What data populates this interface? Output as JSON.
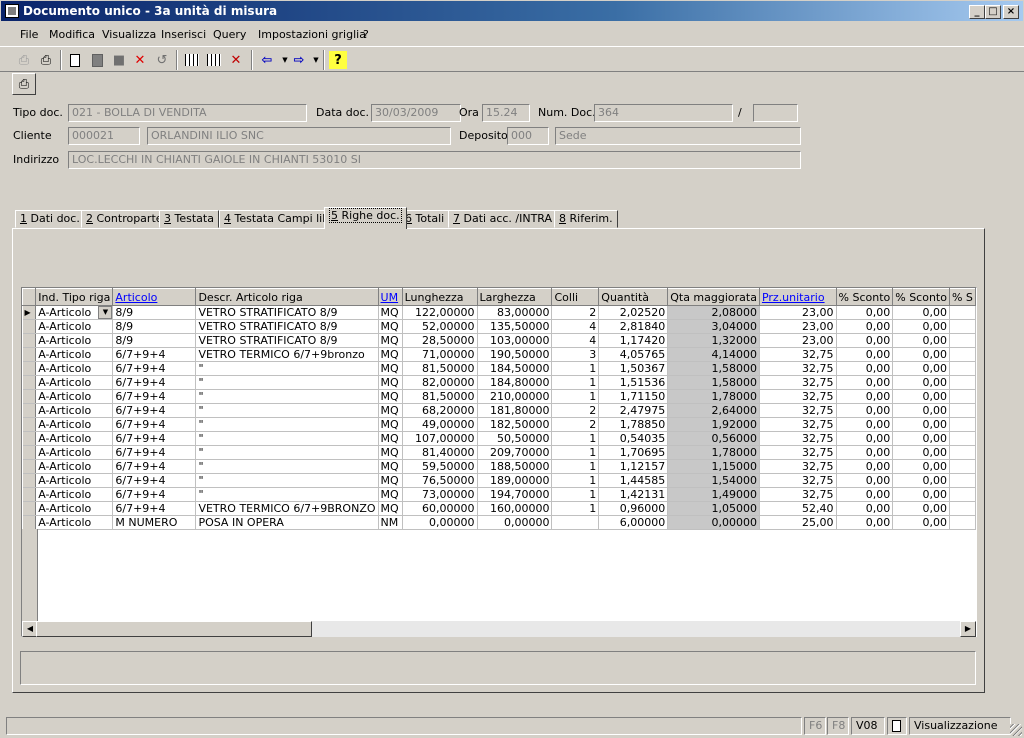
{
  "window": {
    "title": "Documento unico - 3a unità di misura"
  },
  "menu": [
    {
      "label": "File"
    },
    {
      "label": "Modifica"
    },
    {
      "label": "Visualizza"
    },
    {
      "label": "Inserisci"
    },
    {
      "label": "Query"
    },
    {
      "label": "Impostazioni griglia"
    },
    {
      "label": "?"
    }
  ],
  "toolbar_icons": [
    "print-preview-icon",
    "print-icon",
    "new-document-icon",
    "copy-document-icon",
    "save-icon",
    "delete-icon",
    "undo-icon",
    "grid-add-icon",
    "grid-icon",
    "grid-delete-icon",
    "back-arrow-icon",
    "forward-arrow-icon",
    "help-icon",
    "print-icon"
  ],
  "header": {
    "tipo_doc_label": "Tipo doc.",
    "tipo_doc": "021 - BOLLA DI VENDITA",
    "data_doc_label": "Data doc.",
    "data_doc": "30/03/2009",
    "ora_label": "Ora",
    "ora": "15.24",
    "num_doc_label": "Num. Doc.",
    "num_doc": "364",
    "slash": "/",
    "num_doc_suffix": "",
    "cliente_label": "Cliente",
    "cliente_code": "000021",
    "cliente_name": "ORLANDINI ILIO SNC",
    "deposito_label": "Deposito",
    "deposito_code": "000",
    "deposito_name": "Sede",
    "indirizzo_label": "Indirizzo",
    "indirizzo": "LOC.LECCHI IN CHIANTI GAIOLE IN CHIANTI 53010 SI"
  },
  "tabs": [
    {
      "num": "1",
      "label": " Dati doc."
    },
    {
      "num": "2",
      "label": " Controparte"
    },
    {
      "num": "3",
      "label": " Testata"
    },
    {
      "num": "4",
      "label": " Testata Campi lib."
    },
    {
      "num": "5",
      "label": " Righe doc."
    },
    {
      "num": "6",
      "label": " Totali"
    },
    {
      "num": "7",
      "label": " Dati acc. /INTRA"
    },
    {
      "num": "8",
      "label": " Riferim."
    }
  ],
  "grid": {
    "columns": [
      "Ind. Tipo riga",
      "Articolo",
      "Descr. Articolo riga",
      "UM",
      "Lunghezza",
      "Larghezza",
      "Colli",
      "Quantità",
      "Qta maggiorata",
      "Prz.unitario",
      "% Sconto",
      "% Sconto",
      "% S"
    ],
    "rows": [
      [
        "A-Articolo",
        "8/9",
        "VETRO STRATIFICATO 8/9",
        "MQ",
        "122,00000",
        "83,00000",
        "2",
        "2,02520",
        "2,08000",
        "23,00",
        "0,00",
        "0,00"
      ],
      [
        "A-Articolo",
        "8/9",
        "VETRO STRATIFICATO 8/9",
        "MQ",
        "52,00000",
        "135,50000",
        "4",
        "2,81840",
        "3,04000",
        "23,00",
        "0,00",
        "0,00"
      ],
      [
        "A-Articolo",
        "8/9",
        "VETRO STRATIFICATO 8/9",
        "MQ",
        "28,50000",
        "103,00000",
        "4",
        "1,17420",
        "1,32000",
        "23,00",
        "0,00",
        "0,00"
      ],
      [
        "A-Articolo",
        "6/7+9+4",
        "VETRO TERMICO 6/7+9bronzo",
        "MQ",
        "71,00000",
        "190,50000",
        "3",
        "4,05765",
        "4,14000",
        "32,75",
        "0,00",
        "0,00"
      ],
      [
        "A-Articolo",
        "6/7+9+4",
        "\"",
        "MQ",
        "81,50000",
        "184,50000",
        "1",
        "1,50367",
        "1,58000",
        "32,75",
        "0,00",
        "0,00"
      ],
      [
        "A-Articolo",
        "6/7+9+4",
        "\"",
        "MQ",
        "82,00000",
        "184,80000",
        "1",
        "1,51536",
        "1,58000",
        "32,75",
        "0,00",
        "0,00"
      ],
      [
        "A-Articolo",
        "6/7+9+4",
        "\"",
        "MQ",
        "81,50000",
        "210,00000",
        "1",
        "1,71150",
        "1,78000",
        "32,75",
        "0,00",
        "0,00"
      ],
      [
        "A-Articolo",
        "6/7+9+4",
        "\"",
        "MQ",
        "68,20000",
        "181,80000",
        "2",
        "2,47975",
        "2,64000",
        "32,75",
        "0,00",
        "0,00"
      ],
      [
        "A-Articolo",
        "6/7+9+4",
        "\"",
        "MQ",
        "49,00000",
        "182,50000",
        "2",
        "1,78850",
        "1,92000",
        "32,75",
        "0,00",
        "0,00"
      ],
      [
        "A-Articolo",
        "6/7+9+4",
        "\"",
        "MQ",
        "107,00000",
        "50,50000",
        "1",
        "0,54035",
        "0,56000",
        "32,75",
        "0,00",
        "0,00"
      ],
      [
        "A-Articolo",
        "6/7+9+4",
        "\"",
        "MQ",
        "81,40000",
        "209,70000",
        "1",
        "1,70695",
        "1,78000",
        "32,75",
        "0,00",
        "0,00"
      ],
      [
        "A-Articolo",
        "6/7+9+4",
        "\"",
        "MQ",
        "59,50000",
        "188,50000",
        "1",
        "1,12157",
        "1,15000",
        "32,75",
        "0,00",
        "0,00"
      ],
      [
        "A-Articolo",
        "6/7+9+4",
        "\"",
        "MQ",
        "76,50000",
        "189,00000",
        "1",
        "1,44585",
        "1,54000",
        "32,75",
        "0,00",
        "0,00"
      ],
      [
        "A-Articolo",
        "6/7+9+4",
        "\"",
        "MQ",
        "73,00000",
        "194,70000",
        "1",
        "1,42131",
        "1,49000",
        "32,75",
        "0,00",
        "0,00"
      ],
      [
        "A-Articolo",
        "6/7+9+4",
        "VETRO TERMICO 6/7+9BRONZO",
        "MQ",
        "60,00000",
        "160,00000",
        "1",
        "0,96000",
        "1,05000",
        "52,40",
        "0,00",
        "0,00"
      ],
      [
        "A-Articolo",
        "M NUMERO",
        "POSA IN OPERA",
        "NM",
        "0,00000",
        "0,00000",
        "",
        "6,00000",
        "0,00000",
        "25,00",
        "0,00",
        "0,00"
      ]
    ]
  },
  "statusbar": {
    "f6": "F6",
    "f8": "F8",
    "version": "V08",
    "mode": "Visualizzazione"
  }
}
